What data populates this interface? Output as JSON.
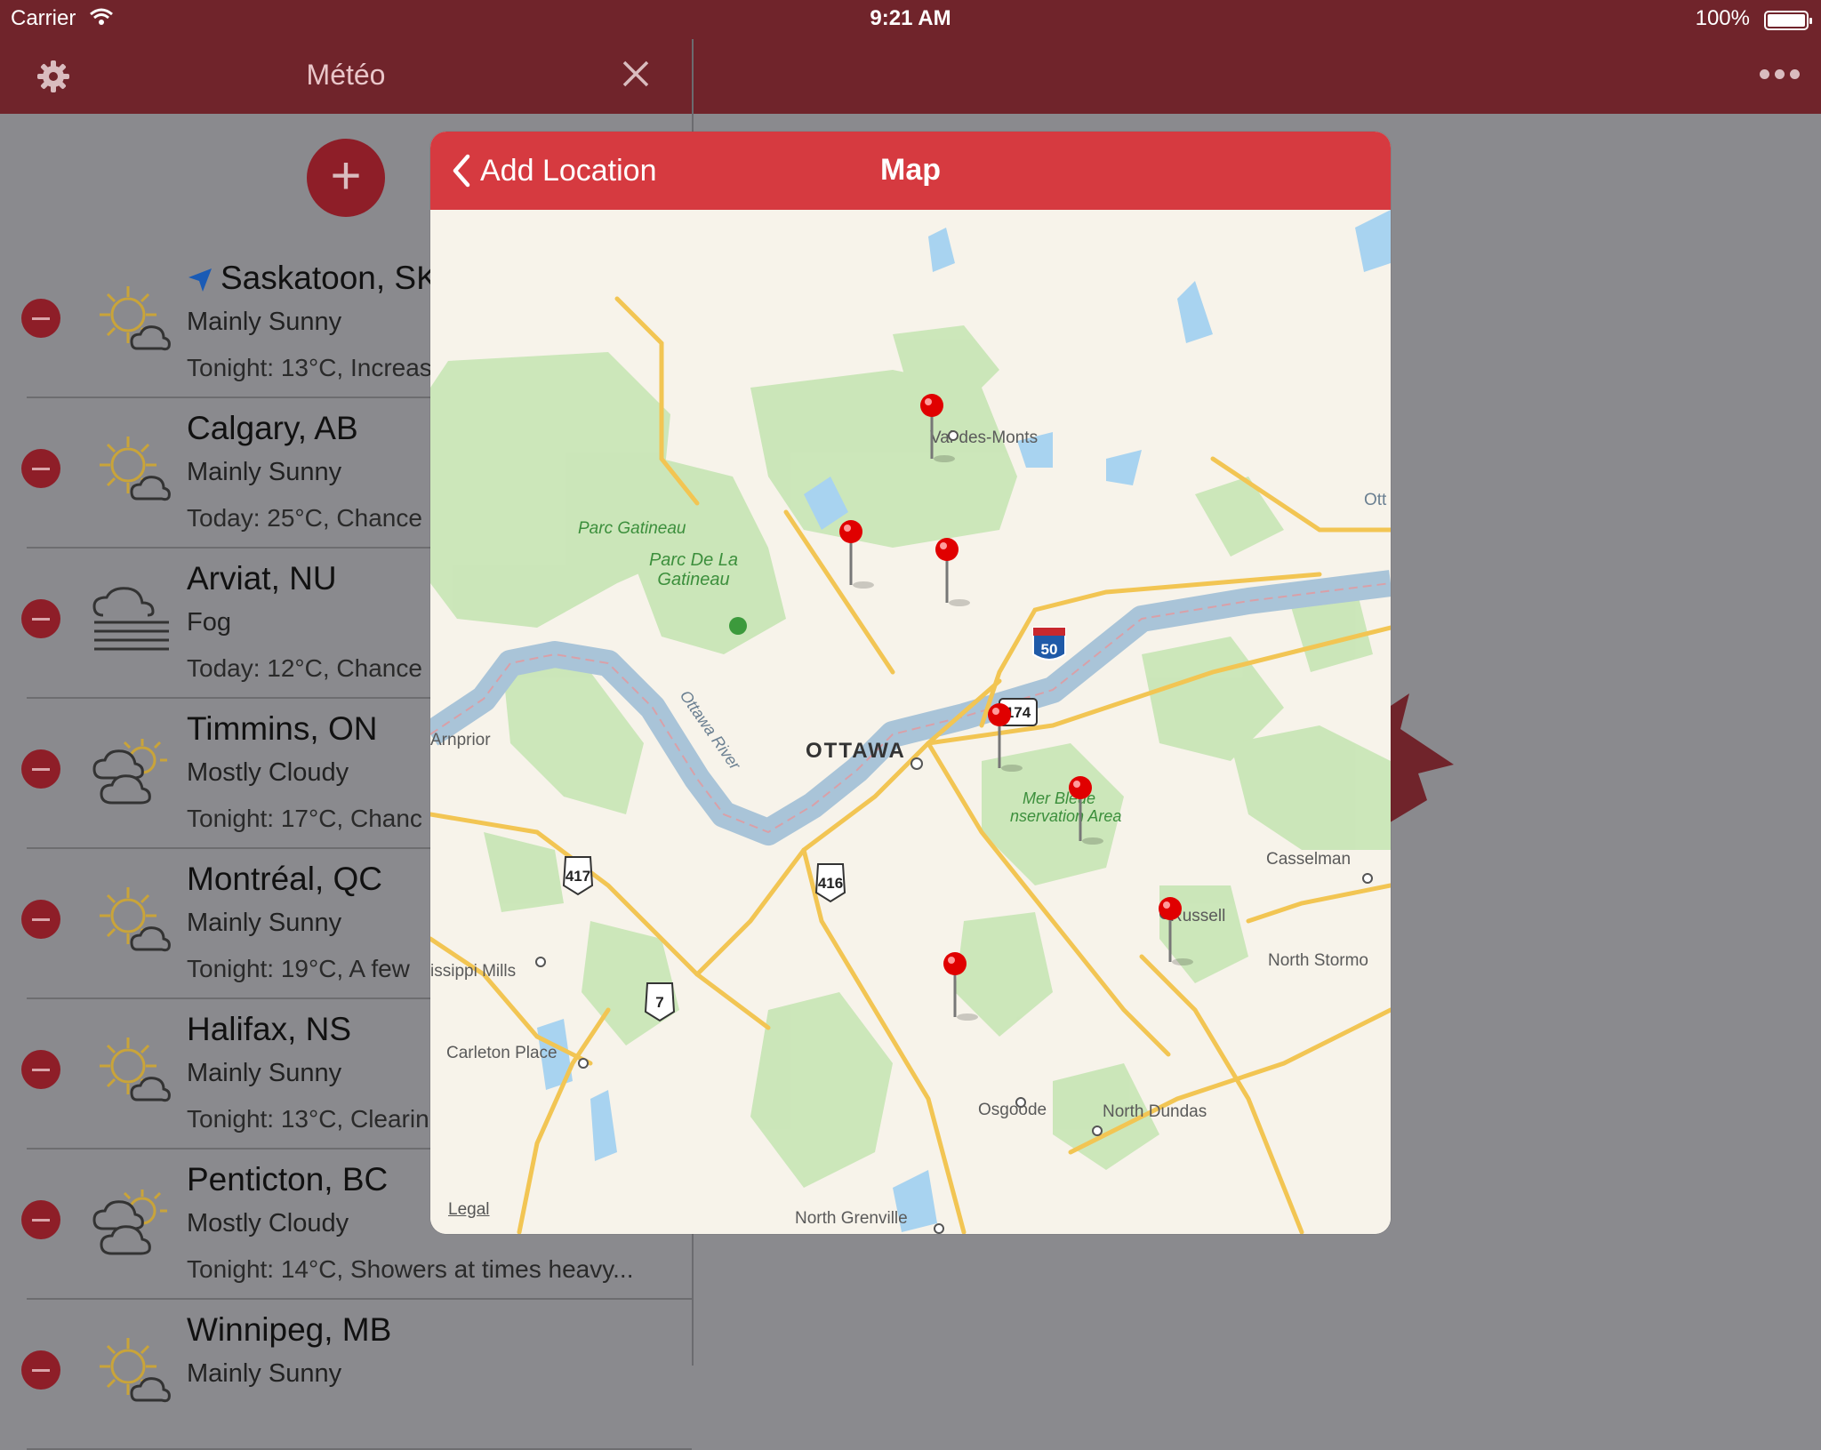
{
  "status_bar": {
    "carrier": "Carrier",
    "time": "9:21 AM",
    "battery": "100%"
  },
  "left_panel": {
    "title": "Météo",
    "cities": [
      {
        "name": "Saskatoon, SK",
        "condition": "Mainly Sunny",
        "forecast": "Tonight: 13°C, Increas",
        "icon": "sun-cloud-icon",
        "current_location": true
      },
      {
        "name": "Calgary, AB",
        "condition": "Mainly Sunny",
        "forecast": "Today: 25°C, Chance",
        "icon": "sun-cloud-icon"
      },
      {
        "name": "Arviat, NU",
        "condition": "Fog",
        "forecast": "Today: 12°C, Chance",
        "icon": "fog-icon"
      },
      {
        "name": "Timmins, ON",
        "condition": "Mostly Cloudy",
        "forecast": "Tonight: 17°C, Chanc",
        "icon": "cloud-sun-icon"
      },
      {
        "name": "Montréal, QC",
        "condition": "Mainly Sunny",
        "forecast": "Tonight: 19°C, A few",
        "icon": "sun-cloud-icon"
      },
      {
        "name": "Halifax, NS",
        "condition": "Mainly Sunny",
        "forecast": "Tonight: 13°C, Clearin",
        "icon": "sun-cloud-icon"
      },
      {
        "name": "Penticton, BC",
        "condition": "Mostly Cloudy",
        "forecast": "Tonight: 14°C, Showers at times heavy...",
        "icon": "cloud-sun-icon"
      },
      {
        "name": "Winnipeg, MB",
        "condition": "Mainly Sunny",
        "forecast": "",
        "icon": "sun-cloud-icon"
      }
    ]
  },
  "modal": {
    "back_label": "Add Location",
    "title": "Map",
    "legal": "Legal",
    "map_labels": {
      "ottawa": "OTTAWA",
      "val_des_monts": "Val-des-Monts",
      "parc_gatineau": "Parc Gatineau",
      "parc_de_la": "Parc De La",
      "gatineau": "Gatineau",
      "ottawa_river": "Ottawa River",
      "arnprior": "Arnprior",
      "mer_bleue": "Mer Bleue",
      "conservation_area": "nservation Area",
      "casselman": "Casselman",
      "russell": "Russell",
      "north_stormont": "North Stormo",
      "mississippi_mills": "issippi Mills",
      "carleton_place": "Carleton Place",
      "osgoode": "Osgoode",
      "north_dundas": "North Dundas",
      "north_grenville": "North Grenville",
      "ott": "Ott"
    },
    "highway_shields": [
      "417",
      "416",
      "7",
      "174",
      "50"
    ]
  },
  "colors": {
    "nav": "#70242b",
    "accent": "#d63a40",
    "pin": "#e00000"
  }
}
